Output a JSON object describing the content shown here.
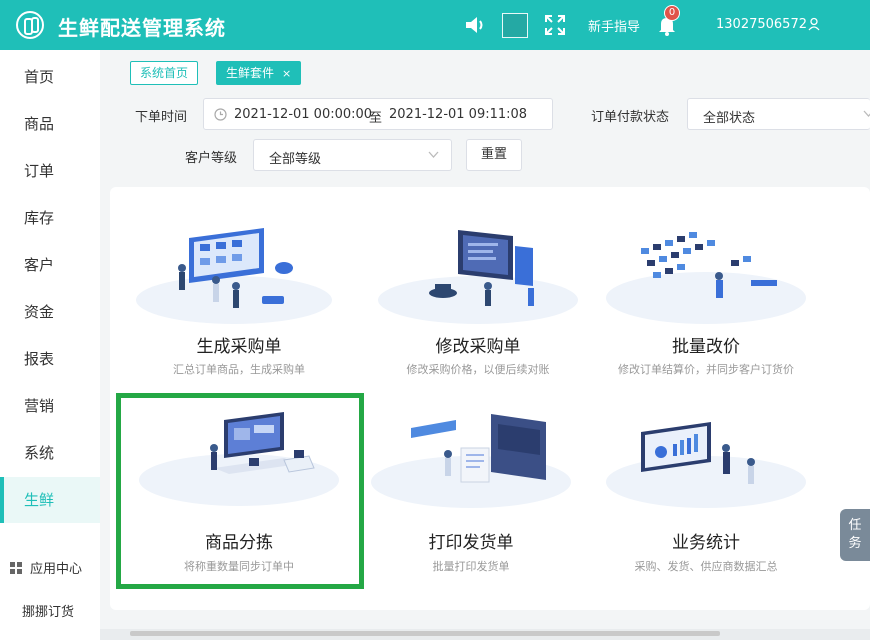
{
  "header": {
    "app_title": "生鲜配送管理系统",
    "guide_label": "新手指导",
    "notification_count": "0",
    "username": "13027506572",
    "brand_color": "#1fbfb8"
  },
  "sidebar": {
    "items": [
      {
        "label": "首页"
      },
      {
        "label": "商品"
      },
      {
        "label": "订单"
      },
      {
        "label": "库存"
      },
      {
        "label": "客户"
      },
      {
        "label": "资金"
      },
      {
        "label": "报表"
      },
      {
        "label": "营销"
      },
      {
        "label": "系统"
      },
      {
        "label": "生鲜",
        "active": true
      }
    ],
    "app_center_label": "应用中心",
    "nana_label": "挪挪订货"
  },
  "tabs": [
    {
      "label": "系统首页"
    },
    {
      "label": "生鲜套件",
      "active": true,
      "close": "×"
    }
  ],
  "filters": {
    "order_time_label": "下单时间",
    "date_start": "2021-12-01 00:00:00",
    "date_separator": "至",
    "date_end": "2021-12-01 09:11:08",
    "payment_status_label": "订单付款状态",
    "payment_status_value": "全部状态",
    "customer_level_label": "客户等级",
    "customer_level_value": "全部等级",
    "reset_label": "重置"
  },
  "cards": [
    {
      "title": "生成采购单",
      "desc": "汇总订单商品，生成采购单"
    },
    {
      "title": "修改采购单",
      "desc": "修改采购价格，以便后续对账"
    },
    {
      "title": "批量改价",
      "desc": "修改订单结算价，并同步客户订货价"
    },
    {
      "title": "商品分拣",
      "desc": "将称重数量同步订单中",
      "highlighted": true
    },
    {
      "title": "打印发货单",
      "desc": "批量打印发货单"
    },
    {
      "title": "业务统计",
      "desc": "采购、发货、供应商数据汇总"
    }
  ],
  "task_tab": {
    "line1": "任",
    "line2": "务"
  },
  "highlight_color": "#24a845"
}
